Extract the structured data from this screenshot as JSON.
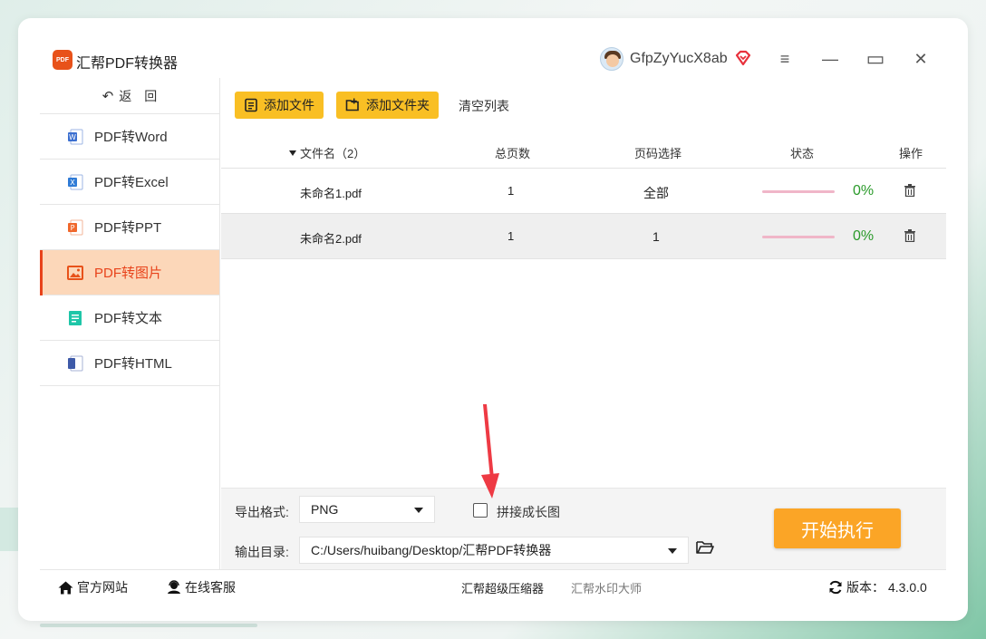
{
  "app": {
    "title": "汇帮PDF转换器",
    "logo_text": "PDF",
    "username": "GfpZyYucX8ab"
  },
  "window_controls": {
    "menu": "≡",
    "minimize": "—",
    "maximize": "▭",
    "close": "✕"
  },
  "sidebar": {
    "back_label": "返　回",
    "items": [
      {
        "label": "PDF转Word",
        "icon": "word-icon",
        "color": "#3b6fd0"
      },
      {
        "label": "PDF转Excel",
        "icon": "excel-icon",
        "color": "#2f7bd6"
      },
      {
        "label": "PDF转PPT",
        "icon": "ppt-icon",
        "color": "#f0682c"
      },
      {
        "label": "PDF转图片",
        "icon": "image-icon",
        "color": "#e8521a",
        "active": true
      },
      {
        "label": "PDF转文本",
        "icon": "text-icon",
        "color": "#1ec6a8"
      },
      {
        "label": "PDF转HTML",
        "icon": "html-icon",
        "color": "#3e5aa8"
      }
    ]
  },
  "toolbar": {
    "add_file": "添加文件",
    "add_folder": "添加文件夹",
    "clear_list": "清空列表"
  },
  "table": {
    "headers": {
      "filename": "文件名（2）",
      "pages": "总页数",
      "page_select": "页码选择",
      "status": "状态",
      "action": "操作"
    },
    "rows": [
      {
        "filename": "未命名1.pdf",
        "pages": "1",
        "page_select": "全部",
        "progress": 0,
        "percent": "0%"
      },
      {
        "filename": "未命名2.pdf",
        "pages": "1",
        "page_select": "1",
        "progress": 0,
        "percent": "0%"
      }
    ]
  },
  "options": {
    "format_label": "导出格式:",
    "format_value": "PNG",
    "stitch_label": "拼接成长图",
    "stitch_checked": false,
    "output_label": "输出目录:",
    "output_path": "C:/Users/huibang/Desktop/汇帮PDF转换器",
    "start_label": "开始执行"
  },
  "footer": {
    "website": "官方网站",
    "support": "在线客服",
    "compressor": "汇帮超级压缩器",
    "watermark": "汇帮水印大师",
    "version_label": "版本：",
    "version": "4.3.0.0"
  },
  "colors": {
    "accent": "#f9bf24",
    "active_nav_bg": "#fcd7b9",
    "active_nav_text": "#e8431b",
    "start_button": "#fba526",
    "percent_green": "#2a9a2a",
    "progress_track": "#f0b6c8",
    "annotation_arrow": "#ee3a44"
  }
}
